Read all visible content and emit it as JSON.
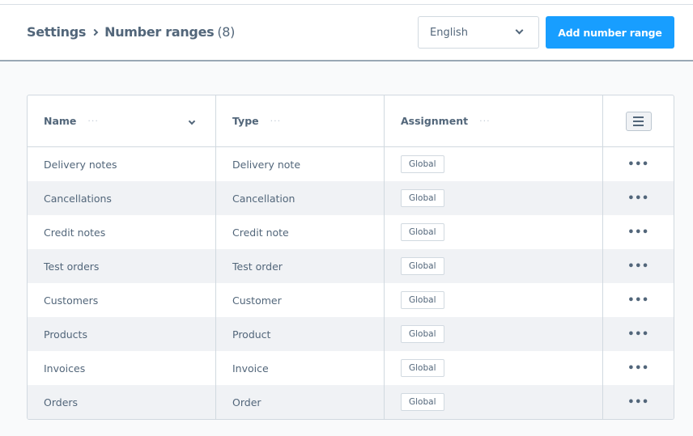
{
  "breadcrumb": {
    "parent": "Settings",
    "current": "Number ranges",
    "count": "(8)"
  },
  "language_select": {
    "value": "English"
  },
  "add_button": {
    "label": "Add number range"
  },
  "grid": {
    "columns": [
      {
        "label": "Name"
      },
      {
        "label": "Type"
      },
      {
        "label": "Assignment"
      }
    ],
    "column_menu_glyph": "···",
    "row_action_glyph": "•••",
    "rows": [
      {
        "name": "Delivery notes",
        "type": "Delivery note",
        "assignment": "Global"
      },
      {
        "name": "Cancellations",
        "type": "Cancellation",
        "assignment": "Global"
      },
      {
        "name": "Credit notes",
        "type": "Credit note",
        "assignment": "Global"
      },
      {
        "name": "Test orders",
        "type": "Test order",
        "assignment": "Global"
      },
      {
        "name": "Customers",
        "type": "Customer",
        "assignment": "Global"
      },
      {
        "name": "Products",
        "type": "Product",
        "assignment": "Global"
      },
      {
        "name": "Invoices",
        "type": "Invoice",
        "assignment": "Global"
      },
      {
        "name": "Orders",
        "type": "Order",
        "assignment": "Global"
      }
    ]
  },
  "colors": {
    "primary": "#189eff",
    "text": "#52667a",
    "border": "#d1d9e0",
    "row_alt": "#f0f2f5"
  }
}
